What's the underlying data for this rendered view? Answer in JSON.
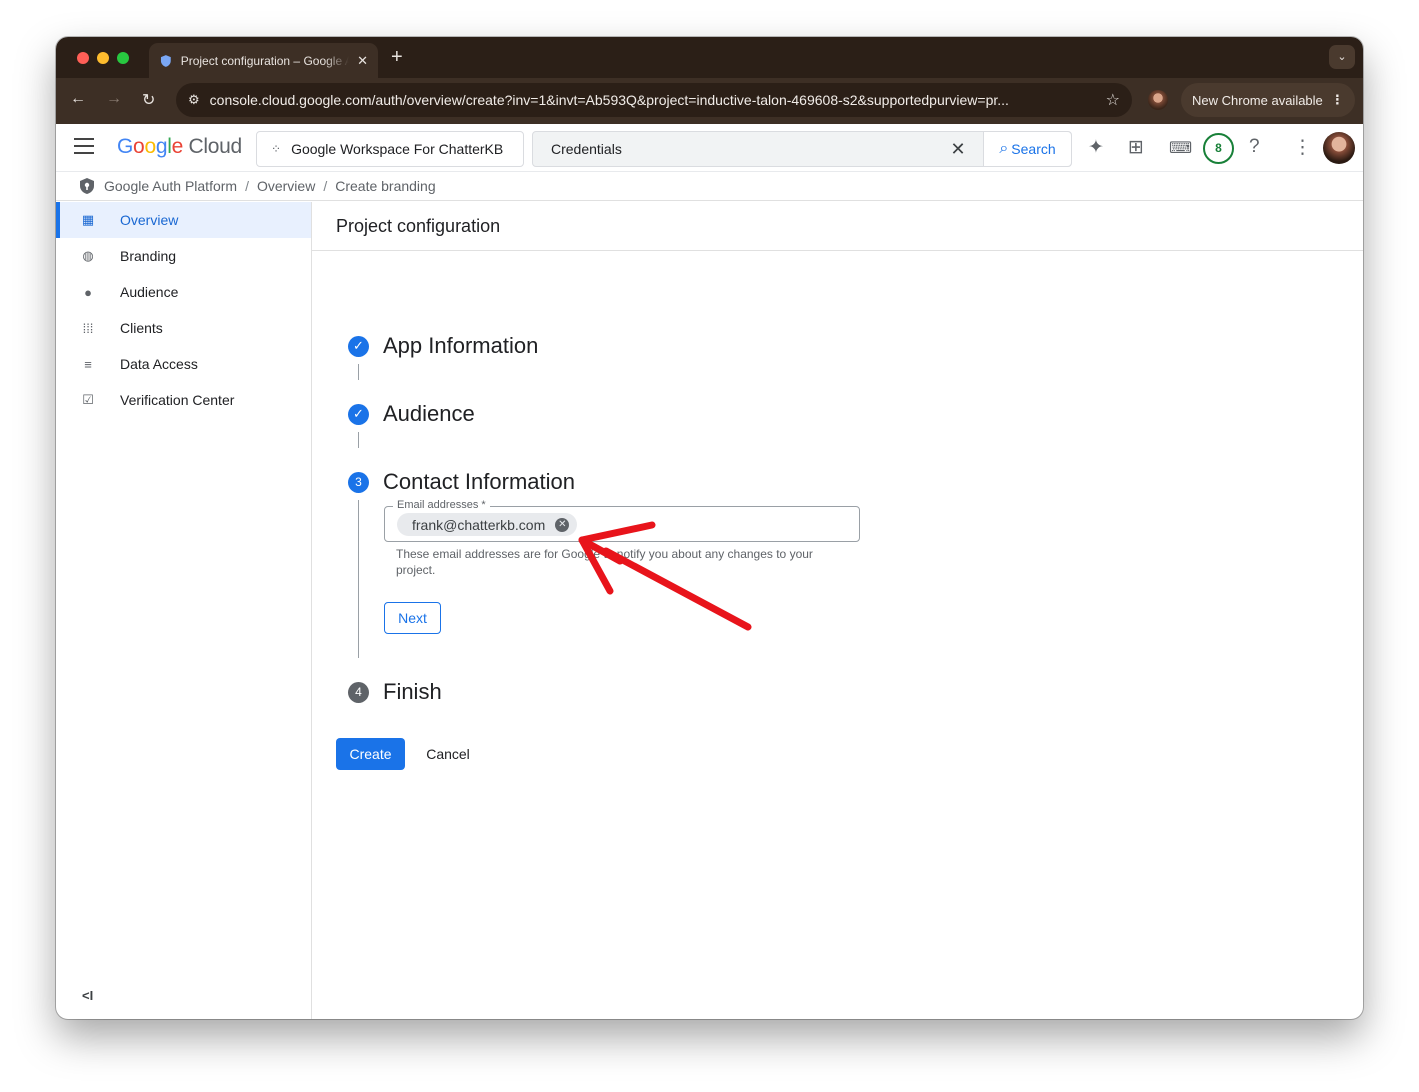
{
  "browser": {
    "tab_title": "Project configuration – Google Auth Platform",
    "url": "console.cloud.google.com/auth/overview/create?inv=1&invt=Ab593Q&project=inductive-talon-469608-s2&supportedpurview=pr...",
    "update_label": "New Chrome available"
  },
  "header": {
    "logo_google": "Google",
    "logo_cloud": "Cloud",
    "project_name": "Google Workspace For ChatterKB",
    "search_value": "Credentials",
    "search_button": "Search",
    "notification_count": "8"
  },
  "breadcrumb": {
    "items": [
      "Google Auth Platform",
      "Overview",
      "Create branding"
    ]
  },
  "sidebar": {
    "items": [
      {
        "label": "Overview",
        "icon": "dashboard-icon",
        "active": true
      },
      {
        "label": "Branding",
        "icon": "palette-icon"
      },
      {
        "label": "Audience",
        "icon": "account-circle-icon"
      },
      {
        "label": "Clients",
        "icon": "grid-icon"
      },
      {
        "label": "Data Access",
        "icon": "data-settings-icon"
      },
      {
        "label": "Verification Center",
        "icon": "checkbox-icon"
      }
    ]
  },
  "main": {
    "title": "Project configuration",
    "steps": [
      {
        "label": "App Information",
        "status": "done"
      },
      {
        "label": "Audience",
        "status": "done"
      },
      {
        "label": "Contact Information",
        "status": "current",
        "number": "3"
      },
      {
        "label": "Finish",
        "status": "todo",
        "number": "4"
      }
    ],
    "email_field": {
      "label": "Email addresses *",
      "chip_value": "frank@chatterkb.com",
      "helper": "These email addresses are for Google to notify you about any changes to your project."
    },
    "next_button": "Next",
    "create_button": "Create",
    "cancel_button": "Cancel"
  },
  "colors": {
    "accent": "#1a73e8",
    "annotation_arrow": "#e8141b"
  }
}
